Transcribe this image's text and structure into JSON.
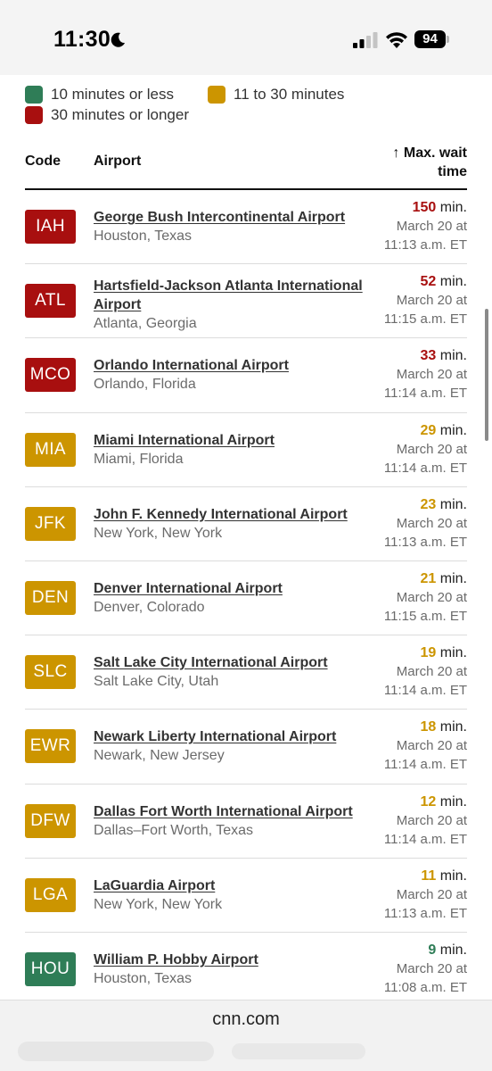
{
  "status_bar": {
    "time": "11:30",
    "battery": "94",
    "icons": [
      "moon-icon",
      "cellular-signal-icon",
      "wifi-icon",
      "battery-icon"
    ]
  },
  "colors": {
    "green": "#2f7d57",
    "amber": "#cc9500",
    "red": "#a80f0f"
  },
  "legend": [
    {
      "label": "10 minutes or less",
      "color": "#2f7d57"
    },
    {
      "label": "11 to 30 minutes",
      "color": "#cc9500"
    },
    {
      "label": "30 minutes or longer",
      "color": "#a80f0f"
    }
  ],
  "table": {
    "headers": {
      "code": "Code",
      "airport": "Airport",
      "wait": "↑ Max. wait time"
    },
    "min_suffix": "min.",
    "rows": [
      {
        "code": "IAH",
        "level": "red",
        "name": "George Bush Intercontinental Airport",
        "location": "Houston, Texas",
        "wait": "150",
        "date": "March 20 at",
        "time": "11:13 a.m. ET"
      },
      {
        "code": "ATL",
        "level": "red",
        "name": "Hartsfield-Jackson Atlanta International Airport",
        "location": "Atlanta, Georgia",
        "wait": "52",
        "date": "March 20 at",
        "time": "11:15 a.m. ET"
      },
      {
        "code": "MCO",
        "level": "red",
        "name": "Orlando International Airport",
        "location": "Orlando, Florida",
        "wait": "33",
        "date": "March 20 at",
        "time": "11:14 a.m. ET"
      },
      {
        "code": "MIA",
        "level": "amber",
        "name": "Miami International Airport",
        "location": "Miami, Florida",
        "wait": "29",
        "date": "March 20 at",
        "time": "11:14 a.m. ET"
      },
      {
        "code": "JFK",
        "level": "amber",
        "name": "John F. Kennedy International Airport",
        "location": "New York, New York",
        "wait": "23",
        "date": "March 20 at",
        "time": "11:13 a.m. ET"
      },
      {
        "code": "DEN",
        "level": "amber",
        "name": "Denver International Airport",
        "location": "Denver, Colorado",
        "wait": "21",
        "date": "March 20 at",
        "time": "11:15 a.m. ET"
      },
      {
        "code": "SLC",
        "level": "amber",
        "name": "Salt Lake City International Airport",
        "location": "Salt Lake City, Utah",
        "wait": "19",
        "date": "March 20 at",
        "time": "11:14 a.m. ET"
      },
      {
        "code": "EWR",
        "level": "amber",
        "name": "Newark Liberty International Airport",
        "location": "Newark, New Jersey",
        "wait": "18",
        "date": "March 20 at",
        "time": "11:14 a.m. ET"
      },
      {
        "code": "DFW",
        "level": "amber",
        "name": "Dallas Fort Worth International Airport",
        "location": "Dallas–Fort Worth, Texas",
        "wait": "12",
        "date": "March 20 at",
        "time": "11:14 a.m. ET"
      },
      {
        "code": "LGA",
        "level": "amber",
        "name": "LaGuardia Airport",
        "location": "New York, New York",
        "wait": "11",
        "date": "March 20 at",
        "time": "11:13 a.m. ET"
      },
      {
        "code": "HOU",
        "level": "green",
        "name": "William P. Hobby Airport",
        "location": "Houston, Texas",
        "wait": "9",
        "date": "March 20 at",
        "time": "11:08 a.m. ET"
      }
    ]
  },
  "browser": {
    "domain": "cnn.com"
  }
}
